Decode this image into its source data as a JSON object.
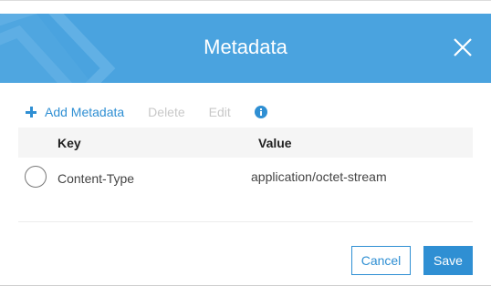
{
  "dialog": {
    "title": "Metadata",
    "colors": {
      "header": "#4aa3df",
      "accent": "#2f8fd3",
      "disabled": "#c8c8c8"
    },
    "icons": {
      "close": "close-icon",
      "add": "plus-icon",
      "info": "info-icon"
    }
  },
  "toolbar": {
    "add_label": "Add Metadata",
    "delete_label": "Delete",
    "edit_label": "Edit"
  },
  "table": {
    "columns": [
      "Key",
      "Value"
    ],
    "rows": [
      {
        "key": "Content-Type",
        "value": "application/octet-stream",
        "selected": false
      }
    ]
  },
  "footer": {
    "cancel_label": "Cancel",
    "save_label": "Save"
  }
}
